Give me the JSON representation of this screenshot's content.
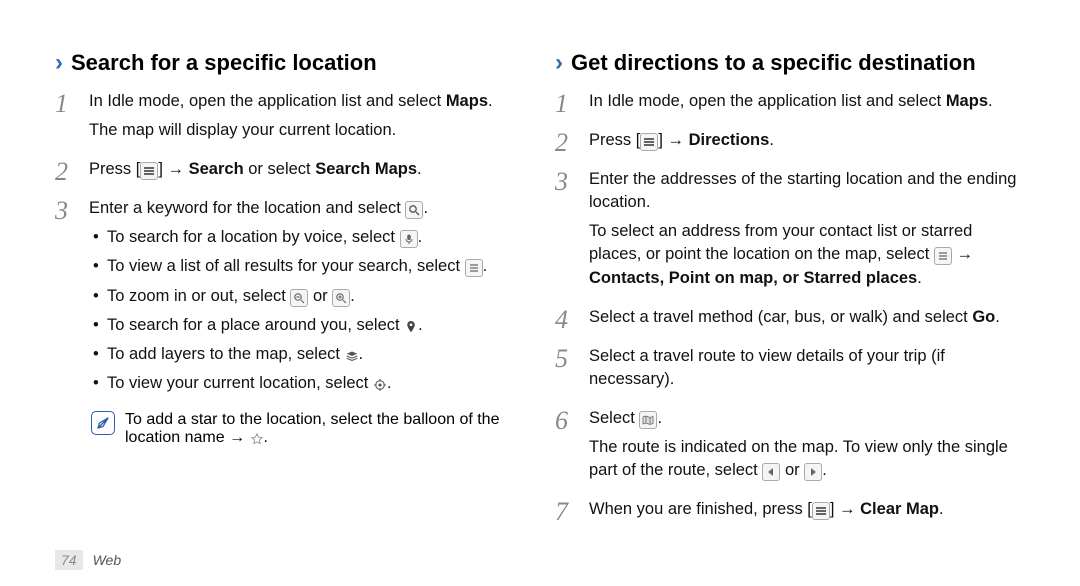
{
  "left": {
    "heading": "Search for a specific location",
    "step1a": "In Idle mode, open the application list and select ",
    "step1bold": "Maps",
    "step1c": ".",
    "step1b": "The map will display your current location.",
    "step2_pre": "Press [",
    "step2_mid": "] → ",
    "step2_bold1": "Search",
    "step2_or": " or select ",
    "step2_bold2": "Search Maps",
    "step2_end": ".",
    "step3": "Enter a keyword for the location and select ",
    "b1": "To search for a location by voice, select ",
    "b2": "To view a list of all results for your search, select ",
    "b3a": "To zoom in or out, select ",
    "b3b": " or ",
    "b4": "To search for a place around you, select ",
    "b5": "To add layers to the map, select ",
    "b6": "To view your current location, select ",
    "note": "To add a star to the location, select the balloon of the location name → ",
    "note_end": "."
  },
  "right": {
    "heading": "Get directions to a specific destination",
    "step1a": "In Idle mode, open the application list and select ",
    "step1bold": "Maps",
    "step1c": ".",
    "step2_pre": "Press [",
    "step2_mid": "] → ",
    "step2_bold": "Directions",
    "step2_end": ".",
    "step3a": "Enter the addresses of the starting location and the ending location.",
    "step3b": "To select an address from your contact list or starred places, or point the location on the map, select ",
    "step3c": " → ",
    "step3_bold": "Contacts, Point on map, or Starred places",
    "step3_end": ".",
    "step4a": "Select a travel method (car, bus, or walk) and select ",
    "step4_bold": "Go",
    "step4_end": ".",
    "step5": "Select a travel route to view details of your trip (if necessary).",
    "step6a": "Select ",
    "step6_end": ".",
    "step6b": "The route is indicated on the map. To view only the single part of the route, select ",
    "step6_or": " or ",
    "step6b_end": ".",
    "step7_pre": "When you are finished, press [",
    "step7_mid": "] → ",
    "step7_bold": "Clear Map",
    "step7_end": "."
  },
  "footer": {
    "page": "74",
    "section": "Web"
  }
}
